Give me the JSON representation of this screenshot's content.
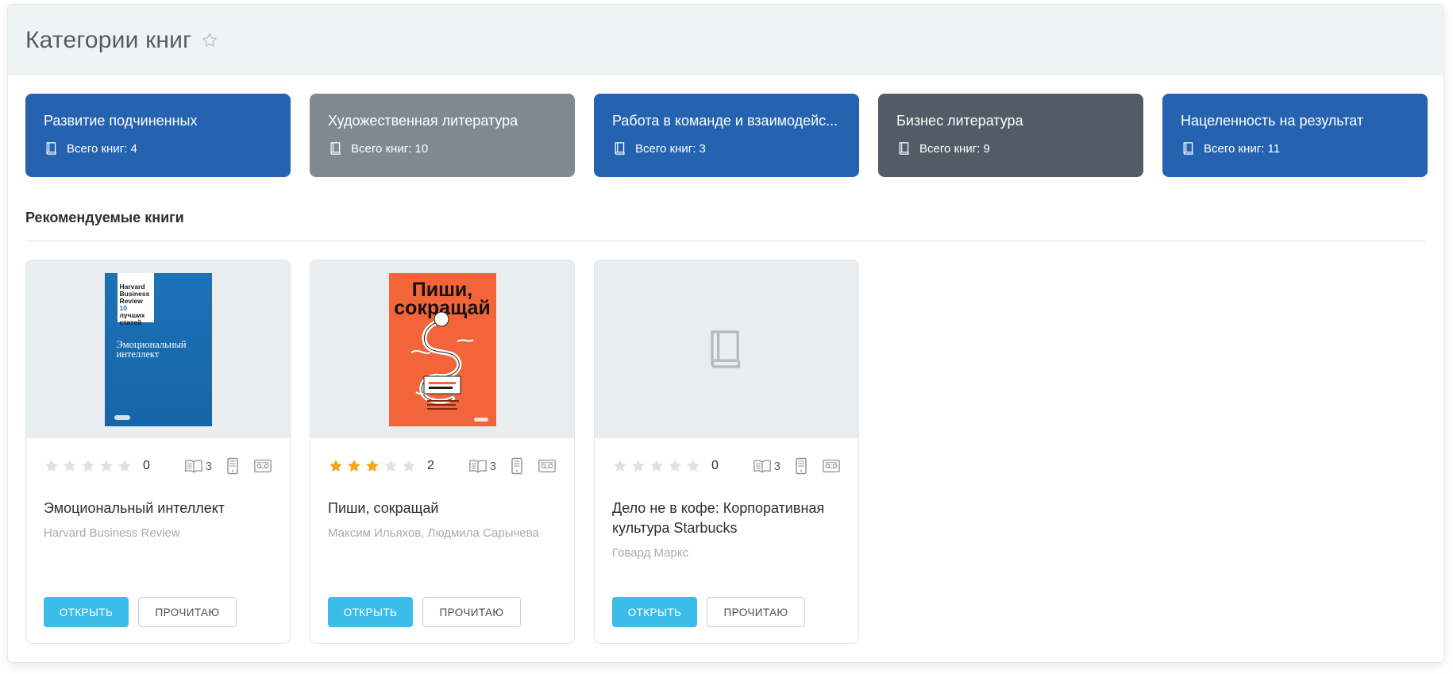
{
  "page": {
    "title": "Категории книг"
  },
  "categories": [
    {
      "name": "Развитие подчиненных",
      "count_text": "Всего книг: 4",
      "color": "#2563b1"
    },
    {
      "name": "Художественная литература",
      "count_text": "Всего книг: 10",
      "color": "#808890"
    },
    {
      "name": "Работа в команде и взаимодейс...",
      "count_text": "Всего книг: 3",
      "color": "#2563b1"
    },
    {
      "name": "Бизнес литература",
      "count_text": "Всего книг: 9",
      "color": "#525c67"
    },
    {
      "name": "Нацеленность на результат",
      "count_text": "Всего книг: 11",
      "color": "#2563b1"
    }
  ],
  "recommended": {
    "title": "Рекомендуемые книги",
    "books": [
      {
        "title": "Эмоциональный интеллект",
        "author": "Harvard Business Review",
        "rating": 0,
        "rating_count": "0",
        "formats_count": "3",
        "cover": {
          "type": "hbr",
          "label_lines": [
            "Harvard",
            "Business",
            "Review",
            "10",
            "лучших",
            "статей"
          ],
          "title_lines": [
            "Эмоциональный",
            "интеллект"
          ]
        }
      },
      {
        "title": "Пиши, сокращай",
        "author": "Максим Ильяхов, Людмила Сарычева",
        "rating": 3,
        "rating_count": "2",
        "formats_count": "3",
        "cover": {
          "type": "pishi",
          "title_lines": [
            "Пиши,",
            "сокращай"
          ]
        }
      },
      {
        "title": "Дело не в кофе: Корпоративная культура Starbucks",
        "author": "Говард Маркс",
        "rating": 0,
        "rating_count": "0",
        "formats_count": "3",
        "cover": {
          "type": "placeholder"
        }
      }
    ],
    "open_label": "ОТКРЫТЬ",
    "read_label": "ПРОЧИТАЮ"
  },
  "colors": {
    "star_filled": "#f4a61d",
    "star_empty": "#dfe2e5",
    "open_button": "#3cbde9"
  },
  "icons": {
    "favorite": "star-outline-icon",
    "category": "book-icon",
    "text_format": "open-book-icon",
    "ebook_format": "tablet-icon",
    "audio_format": "audio-icon",
    "cover_placeholder": "book-placeholder-icon"
  }
}
